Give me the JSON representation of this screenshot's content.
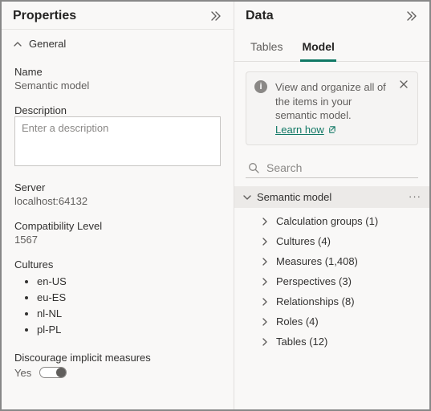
{
  "properties": {
    "title": "Properties",
    "section_general": "General",
    "name_label": "Name",
    "name_value": "Semantic model",
    "description_label": "Description",
    "description_placeholder": "Enter a description",
    "server_label": "Server",
    "server_value": "localhost:64132",
    "compat_label": "Compatibility Level",
    "compat_value": "1567",
    "cultures_label": "Cultures",
    "cultures": [
      "en-US",
      "eu-ES",
      "nl-NL",
      "pl-PL"
    ],
    "discourage_label": "Discourage implicit measures",
    "discourage_value": "Yes"
  },
  "data": {
    "title": "Data",
    "tabs": {
      "tables": "Tables",
      "model": "Model"
    },
    "info_text": "View and organize all of the items in your semantic model.",
    "learn": "Learn how",
    "search_placeholder": "Search",
    "root_label": "Semantic model",
    "tree": [
      {
        "label": "Calculation groups",
        "count": 1
      },
      {
        "label": "Cultures",
        "count": 4
      },
      {
        "label": "Measures",
        "count": 1408
      },
      {
        "label": "Perspectives",
        "count": 3
      },
      {
        "label": "Relationships",
        "count": 8
      },
      {
        "label": "Roles",
        "count": 4
      },
      {
        "label": "Tables",
        "count": 12
      }
    ]
  }
}
